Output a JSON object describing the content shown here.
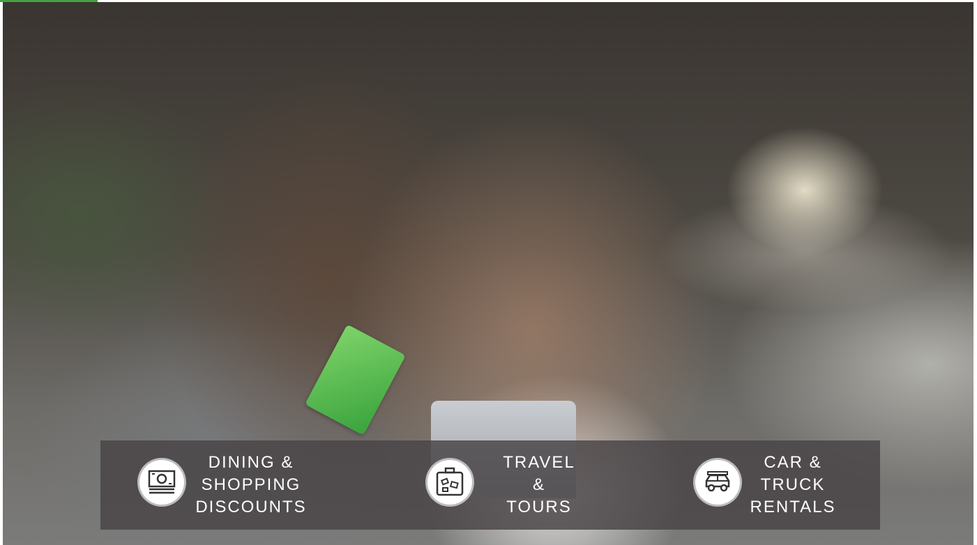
{
  "photo": {
    "icon": "couple-shopping-photo"
  },
  "colors": {
    "accent": "#46a03f",
    "bar": "#484346"
  },
  "features": [
    {
      "icon": "money-bill-icon",
      "lines": [
        "DINING &",
        "SHOPPING",
        "DISCOUNTS"
      ]
    },
    {
      "icon": "luggage-icon",
      "lines": [
        "TRAVEL",
        "&",
        "TOURS"
      ]
    },
    {
      "icon": "car-icon",
      "lines": [
        "CAR &",
        "TRUCK",
        "RENTALS"
      ]
    }
  ]
}
